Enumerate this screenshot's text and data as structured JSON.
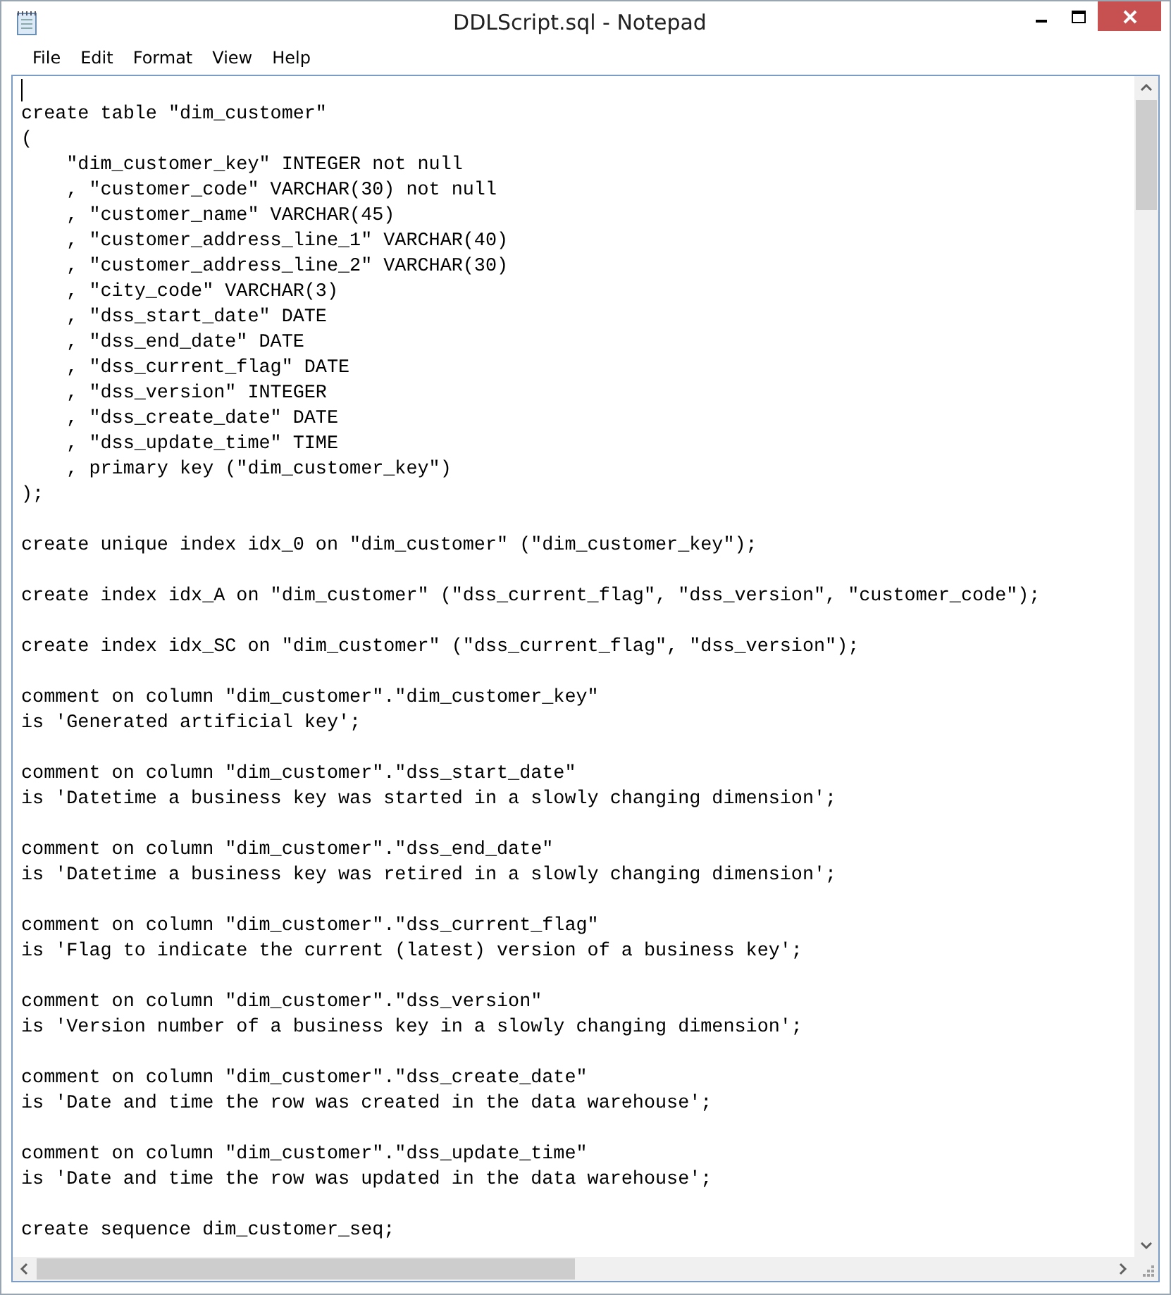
{
  "window": {
    "title": "DDLScript.sql - Notepad"
  },
  "menu": [
    "File",
    "Edit",
    "Format",
    "View",
    "Help"
  ],
  "editor": {
    "blocks": [
      [
        "create table \"dim_customer\"",
        "(",
        "    \"dim_customer_key\" INTEGER not null",
        "    , \"customer_code\" VARCHAR(30) not null",
        "    , \"customer_name\" VARCHAR(45)",
        "    , \"customer_address_line_1\" VARCHAR(40)",
        "    , \"customer_address_line_2\" VARCHAR(30)",
        "    , \"city_code\" VARCHAR(3)",
        "    , \"dss_start_date\" DATE",
        "    , \"dss_end_date\" DATE",
        "    , \"dss_current_flag\" DATE",
        "    , \"dss_version\" INTEGER",
        "    , \"dss_create_date\" DATE",
        "    , \"dss_update_time\" TIME",
        "    , primary key (\"dim_customer_key\")",
        ");"
      ],
      [
        "create unique index idx_0 on \"dim_customer\" (\"dim_customer_key\");"
      ],
      [
        "create index idx_A on \"dim_customer\" (\"dss_current_flag\", \"dss_version\", \"customer_code\");"
      ],
      [
        "create index idx_SC on \"dim_customer\" (\"dss_current_flag\", \"dss_version\");"
      ],
      [
        "comment on column \"dim_customer\".\"dim_customer_key\"",
        "is 'Generated artificial key';"
      ],
      [
        "comment on column \"dim_customer\".\"dss_start_date\"",
        "is 'Datetime a business key was started in a slowly changing dimension';"
      ],
      [
        "comment on column \"dim_customer\".\"dss_end_date\"",
        "is 'Datetime a business key was retired in a slowly changing dimension';"
      ],
      [
        "comment on column \"dim_customer\".\"dss_current_flag\"",
        "is 'Flag to indicate the current (latest) version of a business key';"
      ],
      [
        "comment on column \"dim_customer\".\"dss_version\"",
        "is 'Version number of a business key in a slowly changing dimension';"
      ],
      [
        "comment on column \"dim_customer\".\"dss_create_date\"",
        "is 'Date and time the row was created in the data warehouse';"
      ],
      [
        "comment on column \"dim_customer\".\"dss_update_time\"",
        "is 'Date and time the row was updated in the data warehouse';"
      ],
      [
        "create sequence dim_customer_seq;"
      ]
    ]
  }
}
